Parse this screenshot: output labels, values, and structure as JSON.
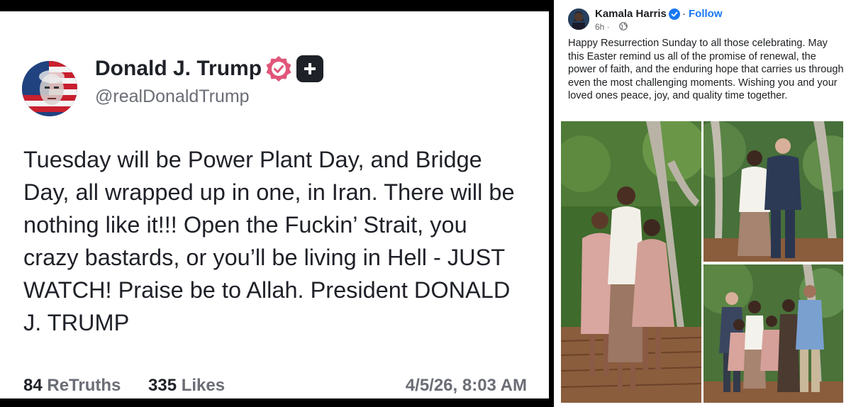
{
  "truth_post": {
    "author_name": "Donald J. Trump",
    "handle": "@realDonaldTrump",
    "text": "Tuesday will be Power Plant Day, and Bridge Day, all wrapped up in one, in Iran. There will be nothing like it!!! Open the Fuckin’ Strait, you crazy bastards, or you’ll be living in Hell - JUST WATCH! Praise be to Allah. President DONALD J. TRUMP",
    "retruths_count": "84",
    "retruths_label": "ReTruths",
    "likes_count": "335",
    "likes_label": "Likes",
    "timestamp": "4/5/26, 8:03 AM",
    "icons": {
      "verified": "verified-badge-icon",
      "plus": "truth-plus-icon"
    },
    "colors": {
      "verified": "#e0567a",
      "text": "#1f2128",
      "muted": "#6b6d76"
    }
  },
  "fb_post": {
    "author_name": "Kamala Harris",
    "follow_label": "Follow",
    "separator": "·",
    "time": "6h ·",
    "text": "Happy Resurrection Sunday to all those celebrating. May this Easter remind us all of the promise of renewal, the power of faith, and the enduring hope that carries us through even the most challenging moments. Wishing you and your loved ones peace, joy, and quality time together.",
    "icons": {
      "verified": "verified-check-icon",
      "audience": "globe-icon"
    },
    "colors": {
      "link": "#1877f2",
      "muted": "#65676b"
    }
  }
}
